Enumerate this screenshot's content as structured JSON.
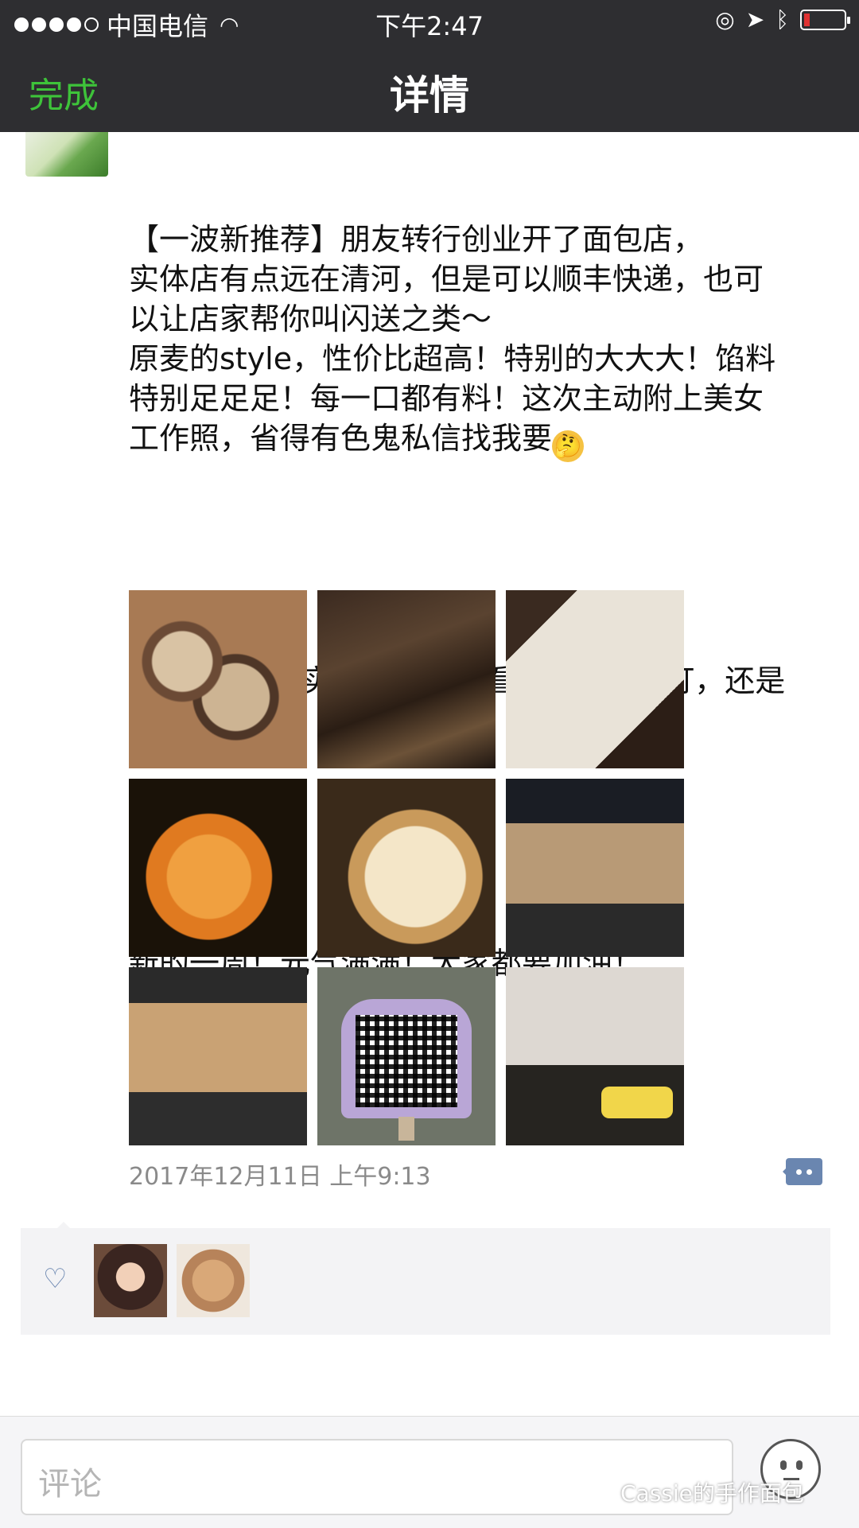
{
  "status_bar": {
    "carrier": "中国电信",
    "time": "下午2:47"
  },
  "nav": {
    "done_label": "完成",
    "title": "详情"
  },
  "post": {
    "paragraphs": [
      "【一波新推荐】朋友转行创业开了面包店，\n实体店有点远在清河，但是可以顺丰快递，也可\n以让店家帮你叫闪送之类～\n原麦的style，性价比超高！特别的大大大！馅料\n特别足足足！每一口都有料！这次主动附上美女\n工作照，省得有色鬼私信找我要",
      "P.S.你们可以实验提大壮，看是不是会被打，还是\n～～",
      "新的一周！元气满满！大家都要加油！"
    ],
    "timestamp": "2017年12月11日 上午9:13"
  },
  "comment": {
    "placeholder": "评论"
  },
  "watermark": "Cassie的手作面包"
}
